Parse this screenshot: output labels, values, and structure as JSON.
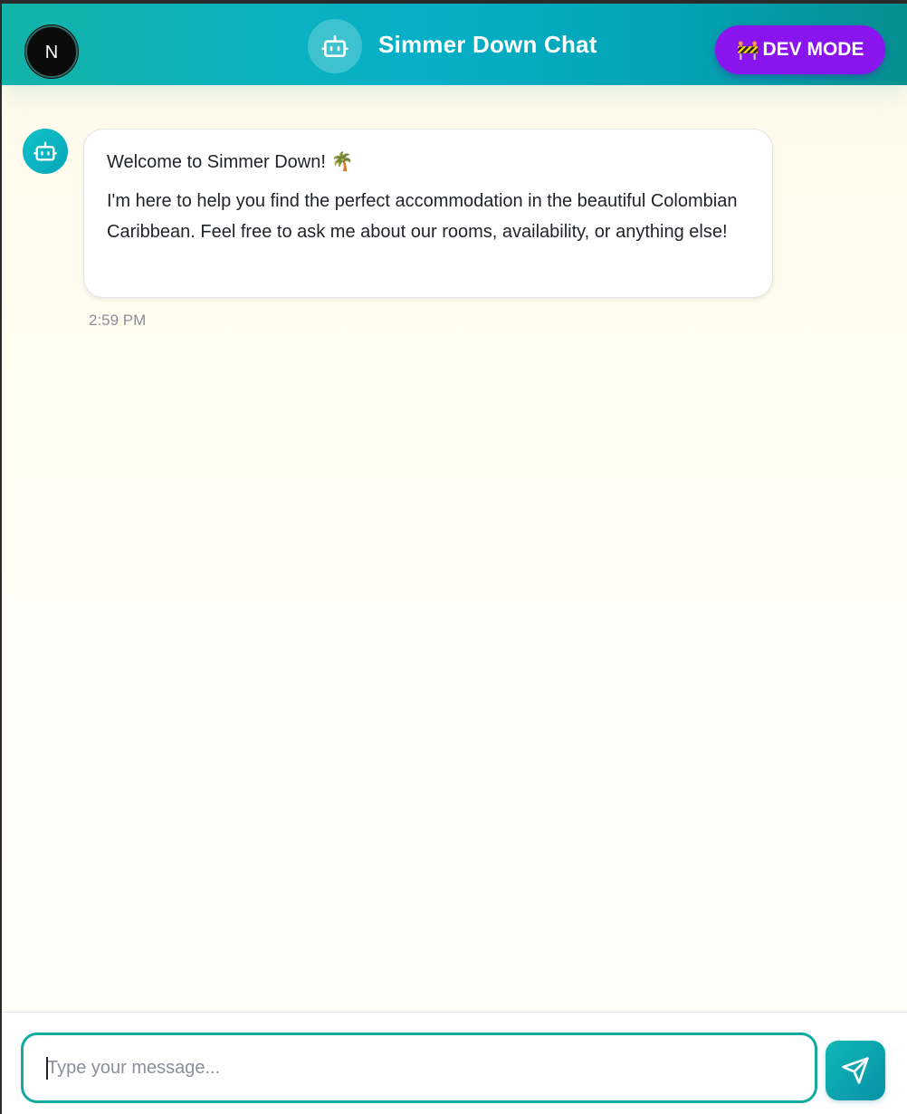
{
  "header": {
    "title": "Simmer Down Chat",
    "dev_mode_emoji": "🚧",
    "dev_mode_label": "DEV MODE",
    "logo_letter": "N",
    "logo_icon": "nextjs-logo-icon",
    "bot_icon": "robot-icon"
  },
  "messages": [
    {
      "sender": "bot",
      "avatar_icon": "robot-icon",
      "line1": "Welcome to Simmer Down!",
      "line1_emoji": "🌴",
      "line2": "I'm here to help you find the perfect accommodation in the beautiful Colombian Caribbean. Feel free to ask me about our rooms, availability, or anything else!",
      "time": "2:59 PM"
    }
  ],
  "composer": {
    "placeholder": "Type your message...",
    "value": "",
    "send_icon": "send-icon"
  },
  "colors": {
    "header_gradient_start": "#12b3a8",
    "header_gradient_mid": "#07b0c8",
    "header_gradient_end": "#058f90",
    "dev_mode_bg": "#8a14ee",
    "input_border": "#12aaa0",
    "background": "#fffaea"
  }
}
